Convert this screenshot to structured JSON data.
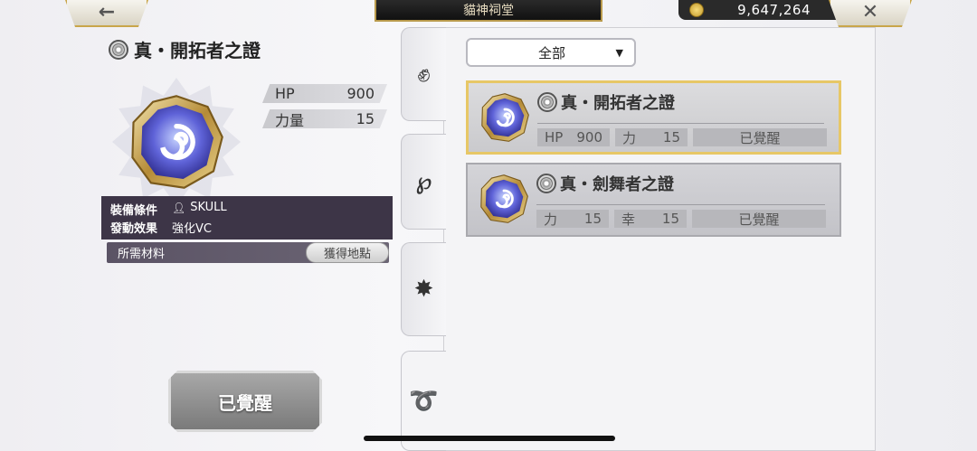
{
  "topbar": {
    "back_icon": "arrow-left-icon",
    "close_icon": "close-icon",
    "title": "貓神祠堂",
    "gold": "9,647,264"
  },
  "detail": {
    "name": "真・開拓者之證",
    "stats": [
      {
        "label": "HP",
        "value": "900"
      },
      {
        "label": "力量",
        "value": "15"
      }
    ],
    "equip_condition_label": "裝備條件",
    "equip_condition_value": "SKULL",
    "effect_label": "發動效果",
    "effect_value": "強化VC",
    "materials_label": "所需材料",
    "obtain_button": "獲得地點",
    "awaken_button": "已覺醒"
  },
  "filter": {
    "selected": "全部"
  },
  "cards": [
    {
      "name": "真・開拓者之證",
      "stat1_label": "HP",
      "stat1_value": "900",
      "stat2_label": "力",
      "stat2_value": "15",
      "status": "已覺醒"
    },
    {
      "name": "真・劍舞者之證",
      "stat1_label": "力",
      "stat1_value": "15",
      "stat2_label": "幸",
      "stat2_value": "15",
      "status": "已覺醒"
    }
  ],
  "tabs": [
    "fist-icon",
    "swirl-hook-icon",
    "compass-star-icon",
    "spiral-icon"
  ],
  "colors": {
    "accent_gold": "#e7c766",
    "panel_dark": "#3d3547"
  }
}
